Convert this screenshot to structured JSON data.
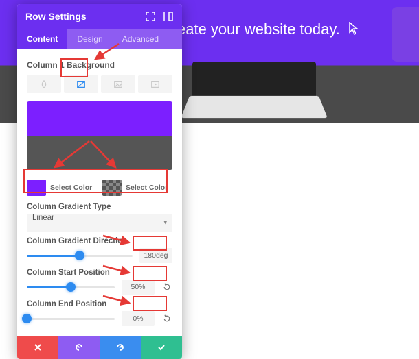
{
  "hero": {
    "text": "eate your website today."
  },
  "panel": {
    "title": "Row Settings",
    "tabs": {
      "content": "Content",
      "design": "Design",
      "advanced": "Advanced"
    },
    "section_bg": "Column 1 Background",
    "select_color": "Select Color",
    "gradient_type": {
      "label": "Column Gradient Type",
      "value": "Linear"
    },
    "gradient_dir": {
      "label": "Column Gradient Direction",
      "value": "180deg",
      "pct": 50
    },
    "start_pos": {
      "label": "Column Start Position",
      "value": "50%",
      "pct": 50
    },
    "end_pos": {
      "label": "Column End Position",
      "value": "0%",
      "pct": 0
    },
    "colors": {
      "accent": "#6c2ff0",
      "preview_top": "#7c1fff",
      "preview_bottom": "#555555"
    }
  }
}
